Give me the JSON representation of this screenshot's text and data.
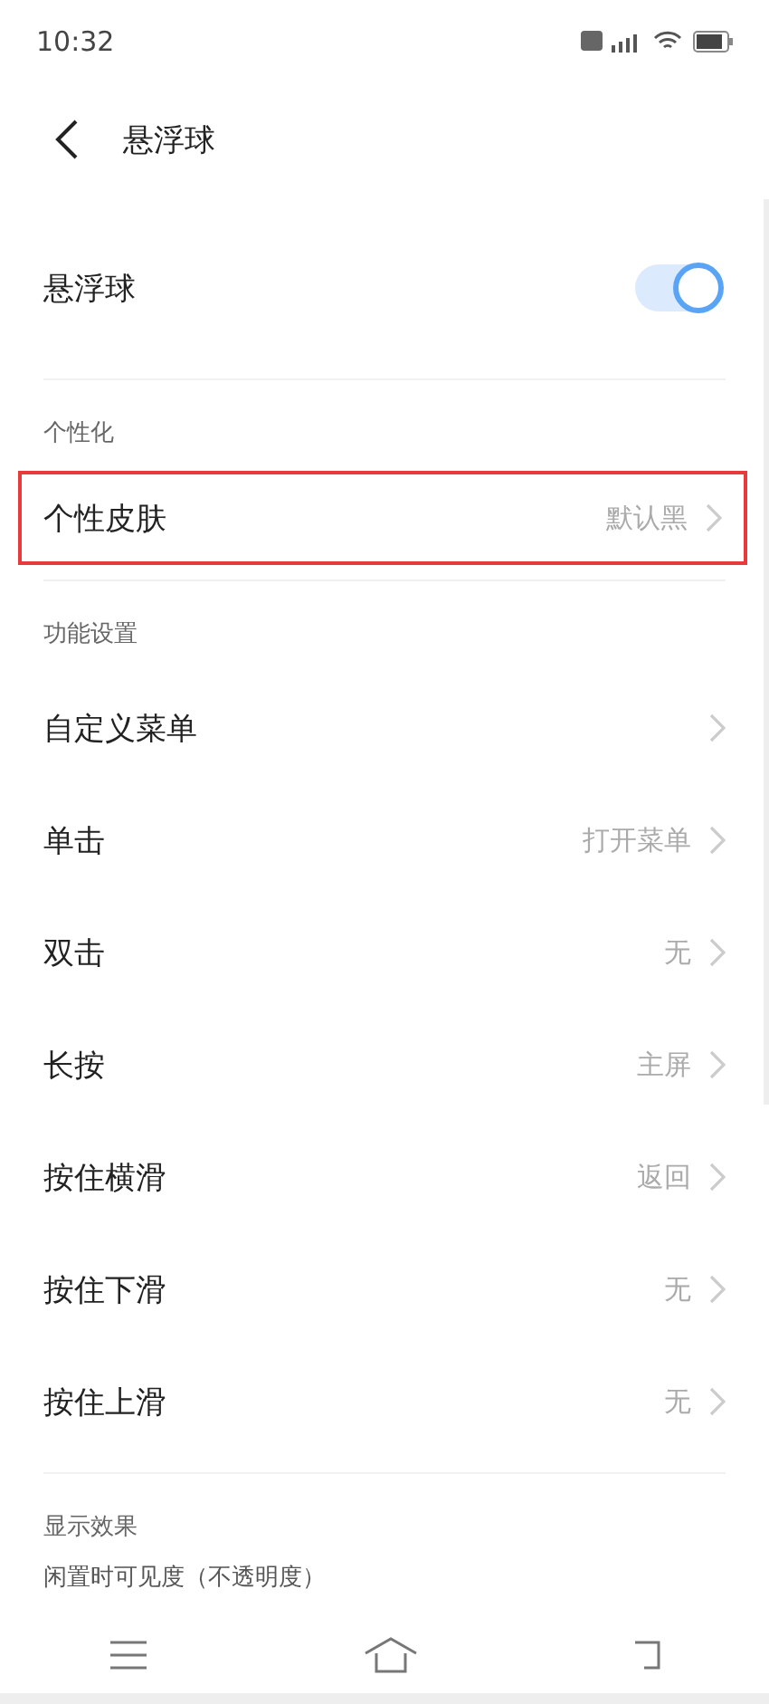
{
  "status_bar": {
    "time": "10:32"
  },
  "header": {
    "title": "悬浮球"
  },
  "toggle_row": {
    "label": "悬浮球",
    "on": true
  },
  "sections": [
    {
      "title": "个性化",
      "rows": [
        {
          "label": "个性皮肤",
          "value": "默认黑",
          "highlighted": true
        }
      ]
    },
    {
      "title": "功能设置",
      "rows": [
        {
          "label": "自定义菜单",
          "highlighted": false
        },
        {
          "label": "单击",
          "value": "打开菜单",
          "highlighted": false
        },
        {
          "label": "双击",
          "value": "无",
          "highlighted": false
        },
        {
          "label": "长按",
          "value": "主屏",
          "highlighted": false
        },
        {
          "label": "按住横滑",
          "value": "返回",
          "highlighted": false
        },
        {
          "label": "按住下滑",
          "value": "无",
          "highlighted": false
        },
        {
          "label": "按住上滑",
          "value": "无",
          "highlighted": false
        }
      ]
    },
    {
      "title": "显示效果"
    }
  ],
  "partial_text": "闲置时可见度（不透明度）"
}
